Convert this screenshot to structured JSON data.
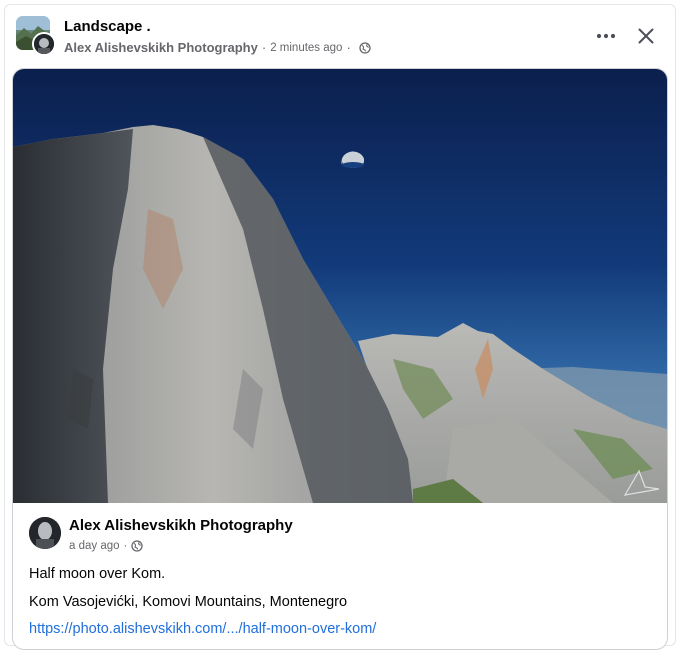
{
  "header": {
    "title": "Landscape .",
    "author": "Alex Alishevskikh Photography",
    "dot": "·",
    "time": "2  minutes ago",
    "privacy_icon": "globe-icon",
    "more_icon": "more-horizontal-icon",
    "close_icon": "close-icon"
  },
  "shared_post": {
    "author": "Alex Alishevskikh Photography",
    "time": "a  day ago",
    "dot": "·",
    "privacy_icon": "globe-icon",
    "text_line1": "Half moon over Kom.",
    "text_line2": "Kom Vasojevićki, Komovi Mountains, Montenegro",
    "link": "https://photo.alishevskikh.com/.../half-moon-over-kom/"
  },
  "colors": {
    "link": "#216fdb",
    "muted": "#65676b",
    "text": "#050505",
    "sky_top": "#0b1f4d",
    "sky_bottom": "#4a86c0"
  }
}
